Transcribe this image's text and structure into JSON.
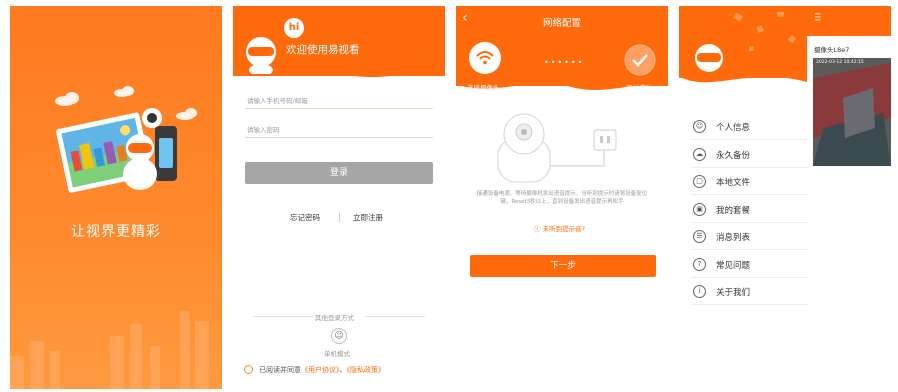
{
  "splash": {
    "slogan": "让视界更精彩"
  },
  "login": {
    "welcome": "欢迎使用易视看",
    "hi_badge": "hi",
    "phone_placeholder": "请输入手机号码/邮箱",
    "password_placeholder": "请输入密码",
    "login_label": "登录",
    "forgot_label": "忘记密码",
    "register_label": "立即注册",
    "other_methods": "其他登录方式",
    "standalone_label": "单机模式",
    "agreement_prefix": "已阅读并同意",
    "user_agreement": "《用户协议》",
    "separator": "、",
    "privacy_policy": "《隐私政策》"
  },
  "network": {
    "title": "网络配置",
    "step1_label": "连接摄像头",
    "step2_label": "添加成功",
    "instruction": "接通设备电源，等待摄像机发出语音提示，当听到提示时请将设备复位键，Reset3秒以上，直到设备发出语音提示再松手",
    "hint_link": "未听到提示音?",
    "next_label": "下一步"
  },
  "menu": {
    "camera_title": "摄像头L8e7",
    "timestamp": "2022-03-12 10:42:15",
    "items": [
      {
        "label": "个人信息",
        "icon": "user-icon"
      },
      {
        "label": "永久备份",
        "icon": "cloud-icon"
      },
      {
        "label": "本地文件",
        "icon": "folder-icon"
      },
      {
        "label": "我的套餐",
        "icon": "cart-icon"
      },
      {
        "label": "消息列表",
        "icon": "message-icon"
      },
      {
        "label": "常见问题",
        "icon": "question-icon"
      },
      {
        "label": "关于我们",
        "icon": "info-icon"
      }
    ]
  },
  "colors": {
    "brand": "#ff6a0c",
    "disabled": "#a6a6a6"
  }
}
